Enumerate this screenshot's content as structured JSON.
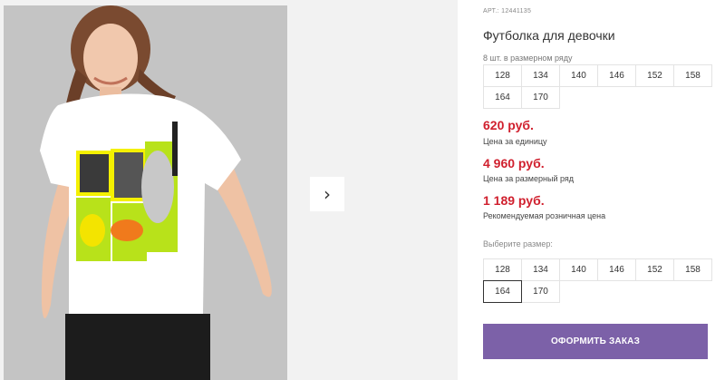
{
  "product": {
    "article": "АРТ.: 12441135",
    "title": "Футболка для девочки"
  },
  "set_sizes": {
    "label": "8 шт. в размерном ряду",
    "items": [
      "128",
      "134",
      "140",
      "146",
      "152",
      "158",
      "164",
      "170"
    ]
  },
  "prices": {
    "unit": {
      "value": "620 руб.",
      "label": "Цена за единицу"
    },
    "set": {
      "value": "4 960 руб.",
      "label": "Цена за размерный ряд"
    },
    "retail": {
      "value": "1 189 руб.",
      "label": "Рекомендуемая розничная цена"
    }
  },
  "size_picker": {
    "label": "Выберите размер:",
    "items": [
      "128",
      "134",
      "140",
      "146",
      "152",
      "158",
      "164",
      "170"
    ],
    "selected": "164"
  },
  "order_button": {
    "label": "ОФОРМИТЬ ЗАКАЗ"
  },
  "colors": {
    "price": "#d0202e",
    "button": "#7c61a8"
  },
  "icons": {
    "next": "chevron-right-icon"
  }
}
